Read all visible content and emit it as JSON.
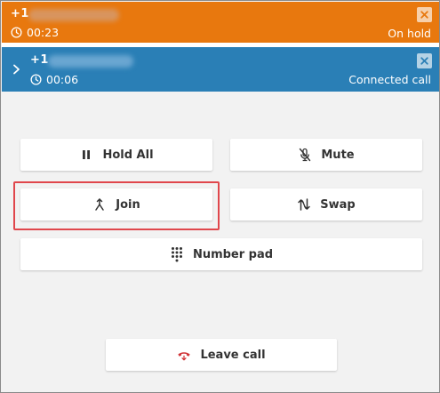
{
  "calls": [
    {
      "number_prefix": "+1",
      "timer": "00:23",
      "status": "On hold",
      "color": "#e8780e"
    },
    {
      "number_prefix": "+1",
      "timer": "00:06",
      "status": "Connected call",
      "color": "#2a7fb6"
    }
  ],
  "controls": {
    "hold_all": "Hold All",
    "mute": "Mute",
    "join": "Join",
    "swap": "Swap",
    "number_pad": "Number pad",
    "leave_call": "Leave call"
  },
  "icons": {
    "close": "close-icon",
    "clock": "clock-icon",
    "chevron": "chevron-right-icon",
    "pause": "pause-icon",
    "mute": "microphone-off-icon",
    "join": "merge-icon",
    "swap": "swap-icon",
    "dialpad": "dialpad-icon",
    "hangup": "hangup-phone-icon"
  },
  "colors": {
    "on_hold": "#e8780e",
    "connected": "#2a7fb6",
    "leave_icon": "#d13438",
    "highlight": "#e0474c"
  }
}
